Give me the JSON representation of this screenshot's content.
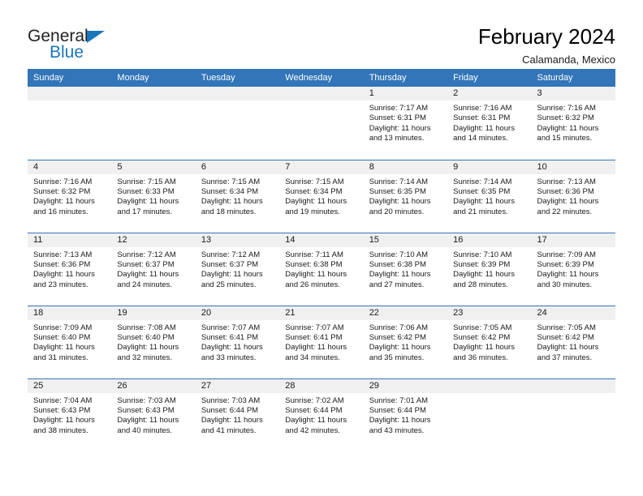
{
  "logo": {
    "word_top": "General",
    "word_bottom": "Blue",
    "accent_color": "#1b76bc",
    "triangle_icon": "triangle-icon"
  },
  "header": {
    "title": "February 2024",
    "subtitle": "Calamanda, Mexico"
  },
  "calendar": {
    "header_bg": "#3275b8",
    "daynum_band_bg": "#f0f0f0",
    "weekday_headers": [
      "Sunday",
      "Monday",
      "Tuesday",
      "Wednesday",
      "Thursday",
      "Friday",
      "Saturday"
    ],
    "weeks": [
      [
        {
          "day": "",
          "lines": []
        },
        {
          "day": "",
          "lines": []
        },
        {
          "day": "",
          "lines": []
        },
        {
          "day": "",
          "lines": []
        },
        {
          "day": "1",
          "lines": [
            "Sunrise: 7:17 AM",
            "Sunset: 6:31 PM",
            "Daylight: 11 hours",
            "and 13 minutes."
          ]
        },
        {
          "day": "2",
          "lines": [
            "Sunrise: 7:16 AM",
            "Sunset: 6:31 PM",
            "Daylight: 11 hours",
            "and 14 minutes."
          ]
        },
        {
          "day": "3",
          "lines": [
            "Sunrise: 7:16 AM",
            "Sunset: 6:32 PM",
            "Daylight: 11 hours",
            "and 15 minutes."
          ]
        }
      ],
      [
        {
          "day": "4",
          "lines": [
            "Sunrise: 7:16 AM",
            "Sunset: 6:32 PM",
            "Daylight: 11 hours",
            "and 16 minutes."
          ]
        },
        {
          "day": "5",
          "lines": [
            "Sunrise: 7:15 AM",
            "Sunset: 6:33 PM",
            "Daylight: 11 hours",
            "and 17 minutes."
          ]
        },
        {
          "day": "6",
          "lines": [
            "Sunrise: 7:15 AM",
            "Sunset: 6:34 PM",
            "Daylight: 11 hours",
            "and 18 minutes."
          ]
        },
        {
          "day": "7",
          "lines": [
            "Sunrise: 7:15 AM",
            "Sunset: 6:34 PM",
            "Daylight: 11 hours",
            "and 19 minutes."
          ]
        },
        {
          "day": "8",
          "lines": [
            "Sunrise: 7:14 AM",
            "Sunset: 6:35 PM",
            "Daylight: 11 hours",
            "and 20 minutes."
          ]
        },
        {
          "day": "9",
          "lines": [
            "Sunrise: 7:14 AM",
            "Sunset: 6:35 PM",
            "Daylight: 11 hours",
            "and 21 minutes."
          ]
        },
        {
          "day": "10",
          "lines": [
            "Sunrise: 7:13 AM",
            "Sunset: 6:36 PM",
            "Daylight: 11 hours",
            "and 22 minutes."
          ]
        }
      ],
      [
        {
          "day": "11",
          "lines": [
            "Sunrise: 7:13 AM",
            "Sunset: 6:36 PM",
            "Daylight: 11 hours",
            "and 23 minutes."
          ]
        },
        {
          "day": "12",
          "lines": [
            "Sunrise: 7:12 AM",
            "Sunset: 6:37 PM",
            "Daylight: 11 hours",
            "and 24 minutes."
          ]
        },
        {
          "day": "13",
          "lines": [
            "Sunrise: 7:12 AM",
            "Sunset: 6:37 PM",
            "Daylight: 11 hours",
            "and 25 minutes."
          ]
        },
        {
          "day": "14",
          "lines": [
            "Sunrise: 7:11 AM",
            "Sunset: 6:38 PM",
            "Daylight: 11 hours",
            "and 26 minutes."
          ]
        },
        {
          "day": "15",
          "lines": [
            "Sunrise: 7:10 AM",
            "Sunset: 6:38 PM",
            "Daylight: 11 hours",
            "and 27 minutes."
          ]
        },
        {
          "day": "16",
          "lines": [
            "Sunrise: 7:10 AM",
            "Sunset: 6:39 PM",
            "Daylight: 11 hours",
            "and 28 minutes."
          ]
        },
        {
          "day": "17",
          "lines": [
            "Sunrise: 7:09 AM",
            "Sunset: 6:39 PM",
            "Daylight: 11 hours",
            "and 30 minutes."
          ]
        }
      ],
      [
        {
          "day": "18",
          "lines": [
            "Sunrise: 7:09 AM",
            "Sunset: 6:40 PM",
            "Daylight: 11 hours",
            "and 31 minutes."
          ]
        },
        {
          "day": "19",
          "lines": [
            "Sunrise: 7:08 AM",
            "Sunset: 6:40 PM",
            "Daylight: 11 hours",
            "and 32 minutes."
          ]
        },
        {
          "day": "20",
          "lines": [
            "Sunrise: 7:07 AM",
            "Sunset: 6:41 PM",
            "Daylight: 11 hours",
            "and 33 minutes."
          ]
        },
        {
          "day": "21",
          "lines": [
            "Sunrise: 7:07 AM",
            "Sunset: 6:41 PM",
            "Daylight: 11 hours",
            "and 34 minutes."
          ]
        },
        {
          "day": "22",
          "lines": [
            "Sunrise: 7:06 AM",
            "Sunset: 6:42 PM",
            "Daylight: 11 hours",
            "and 35 minutes."
          ]
        },
        {
          "day": "23",
          "lines": [
            "Sunrise: 7:05 AM",
            "Sunset: 6:42 PM",
            "Daylight: 11 hours",
            "and 36 minutes."
          ]
        },
        {
          "day": "24",
          "lines": [
            "Sunrise: 7:05 AM",
            "Sunset: 6:42 PM",
            "Daylight: 11 hours",
            "and 37 minutes."
          ]
        }
      ],
      [
        {
          "day": "25",
          "lines": [
            "Sunrise: 7:04 AM",
            "Sunset: 6:43 PM",
            "Daylight: 11 hours",
            "and 38 minutes."
          ]
        },
        {
          "day": "26",
          "lines": [
            "Sunrise: 7:03 AM",
            "Sunset: 6:43 PM",
            "Daylight: 11 hours",
            "and 40 minutes."
          ]
        },
        {
          "day": "27",
          "lines": [
            "Sunrise: 7:03 AM",
            "Sunset: 6:44 PM",
            "Daylight: 11 hours",
            "and 41 minutes."
          ]
        },
        {
          "day": "28",
          "lines": [
            "Sunrise: 7:02 AM",
            "Sunset: 6:44 PM",
            "Daylight: 11 hours",
            "and 42 minutes."
          ]
        },
        {
          "day": "29",
          "lines": [
            "Sunrise: 7:01 AM",
            "Sunset: 6:44 PM",
            "Daylight: 11 hours",
            "and 43 minutes."
          ]
        },
        {
          "day": "",
          "lines": []
        },
        {
          "day": "",
          "lines": []
        }
      ]
    ]
  }
}
